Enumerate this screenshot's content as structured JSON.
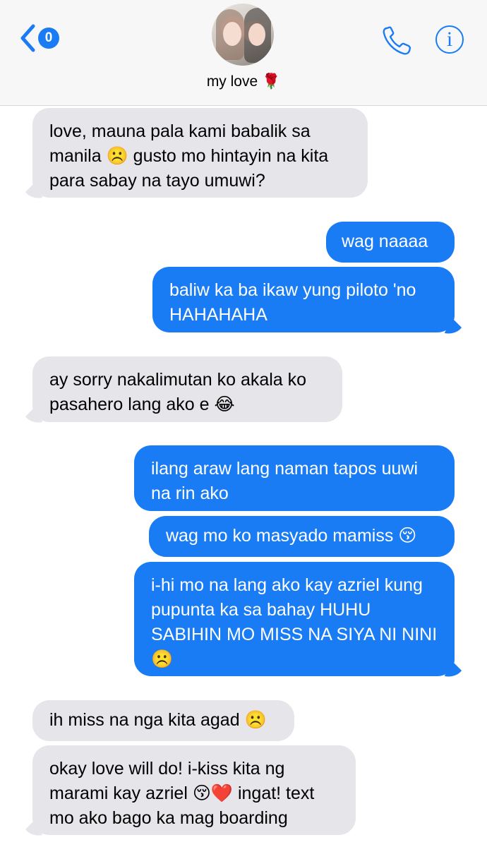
{
  "header": {
    "back_badge": "0",
    "contact_name": "my love",
    "contact_emoji": "🌹",
    "back_icon": "chevron-left-icon",
    "call_icon": "phone-icon",
    "info_icon": "info-icon",
    "info_glyph": "i",
    "accent_color": "#1a7cf5"
  },
  "messages": [
    {
      "from": "them",
      "text": "love, mauna pala kami babalik sa manila ☹️ gusto mo hintayin na kita para sabay na tayo umuwi?"
    },
    {
      "from": "me",
      "text": "wag naaaa"
    },
    {
      "from": "me",
      "text": "baliw ka ba ikaw yung piloto 'no HAHAHAHA"
    },
    {
      "from": "them",
      "text": "ay sorry nakalimutan ko akala ko pasahero lang ako e 😂"
    },
    {
      "from": "me",
      "text": "ilang araw lang naman tapos uuwi na rin ako"
    },
    {
      "from": "me",
      "text": "wag mo ko masyado mamiss 😚"
    },
    {
      "from": "me",
      "text": "i-hi mo na lang ako kay azriel kung pupunta ka sa bahay HUHU SABIHIN MO MISS NA SIYA NI NINI ☹️"
    },
    {
      "from": "them",
      "text": "ih miss na nga kita agad ☹️"
    },
    {
      "from": "them",
      "text": "okay love will do! i-kiss kita ng marami kay azriel 😚❤️ ingat! text mo ako bago ka mag boarding"
    }
  ],
  "colors": {
    "incoming_bubble": "#e5e5ea",
    "outgoing_bubble": "#1a7cf5"
  }
}
